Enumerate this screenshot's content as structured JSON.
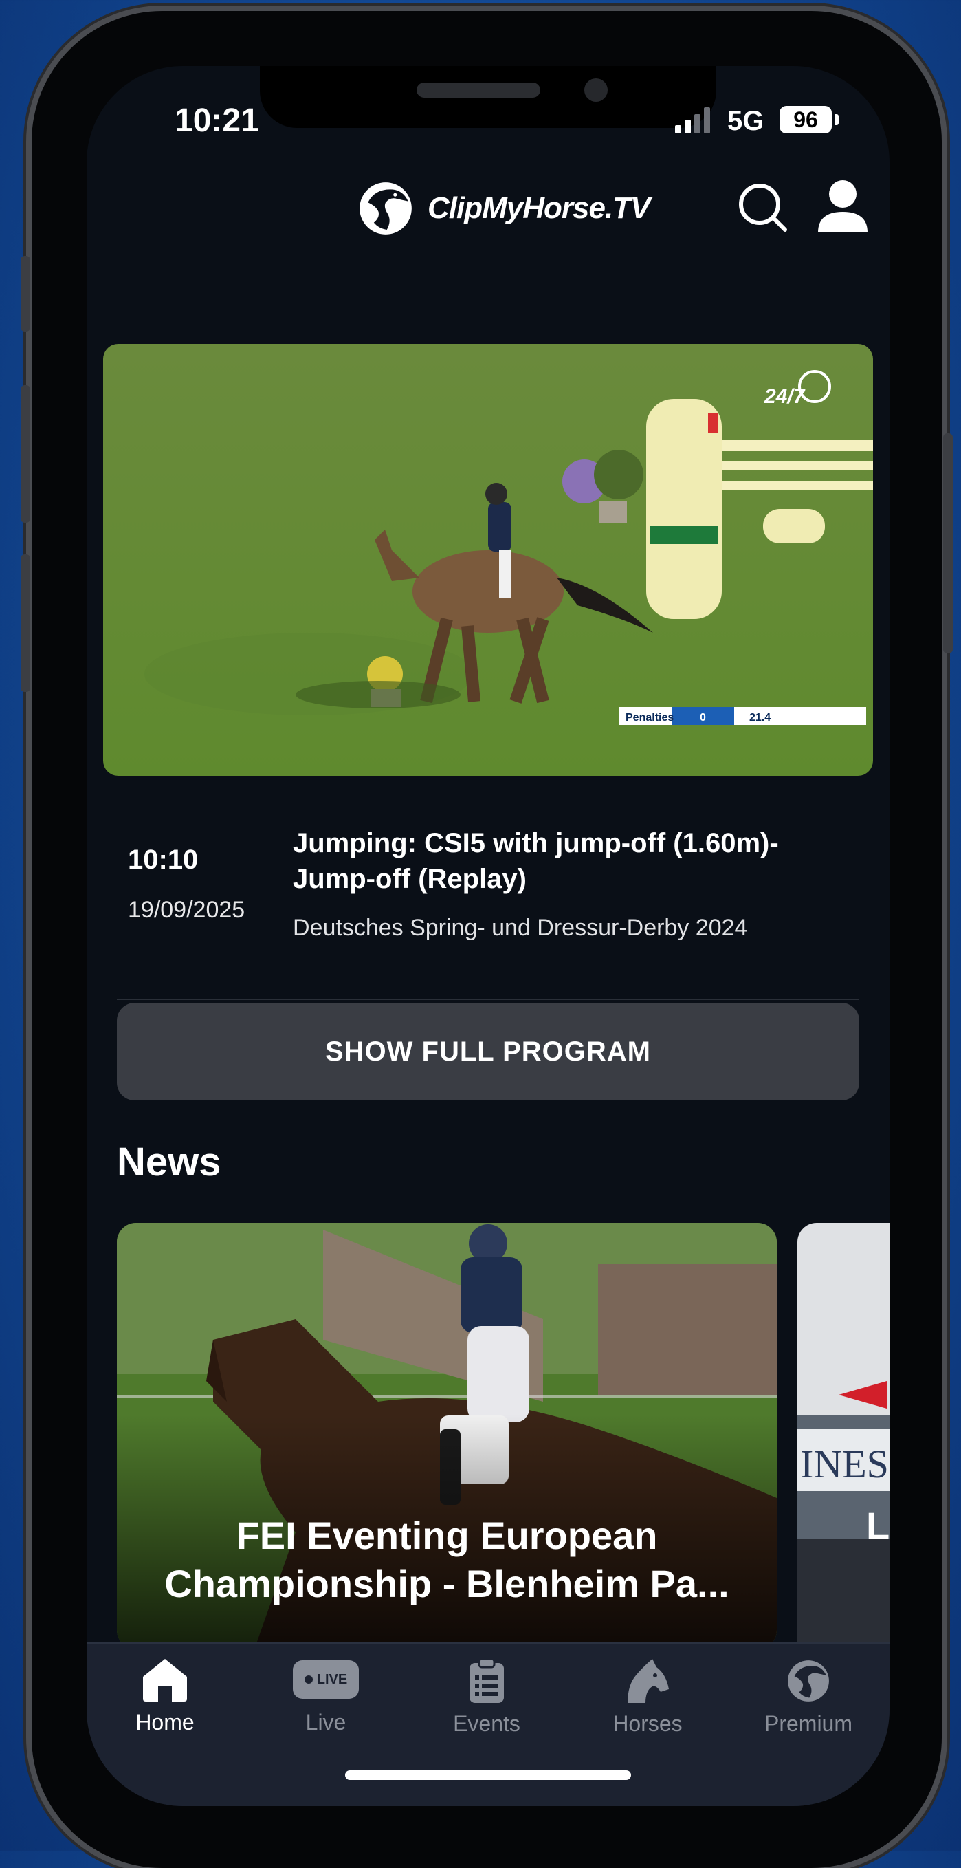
{
  "status_bar": {
    "time": "10:21",
    "network": "5G",
    "battery": "96"
  },
  "header": {
    "brand": "ClipMyHorse.TV"
  },
  "video": {
    "badge": "24/7",
    "score_label": "Penalties",
    "penalties": "0",
    "time": "21.4"
  },
  "program": {
    "time": "10:10",
    "date": "19/09/2025",
    "title": "Jumping: CSI5 with jump-off (1.60m)- Jump-off (Replay)",
    "event": "Deutsches Spring- und Dressur-Derby 2024",
    "button_label": "SHOW FULL PROGRAM"
  },
  "news": {
    "heading": "News",
    "cards": [
      {
        "title": "FEI Eventing European Championship - Blenheim Pa..."
      },
      {
        "title": "L"
      }
    ]
  },
  "tabs": [
    {
      "label": "Home",
      "icon": "home-icon",
      "active": true
    },
    {
      "label": "Live",
      "icon": "live-icon",
      "badge": "LIVE",
      "active": false
    },
    {
      "label": "Events",
      "icon": "clipboard-icon",
      "active": false
    },
    {
      "label": "Horses",
      "icon": "horse-head-icon",
      "active": false
    },
    {
      "label": "Premium",
      "icon": "premium-logo-icon",
      "active": false
    }
  ],
  "colors": {
    "background": "#0a0f17",
    "button": "#3a3d44",
    "tabbar": "#1c2230",
    "inactive_tab": "#8a8f99"
  }
}
